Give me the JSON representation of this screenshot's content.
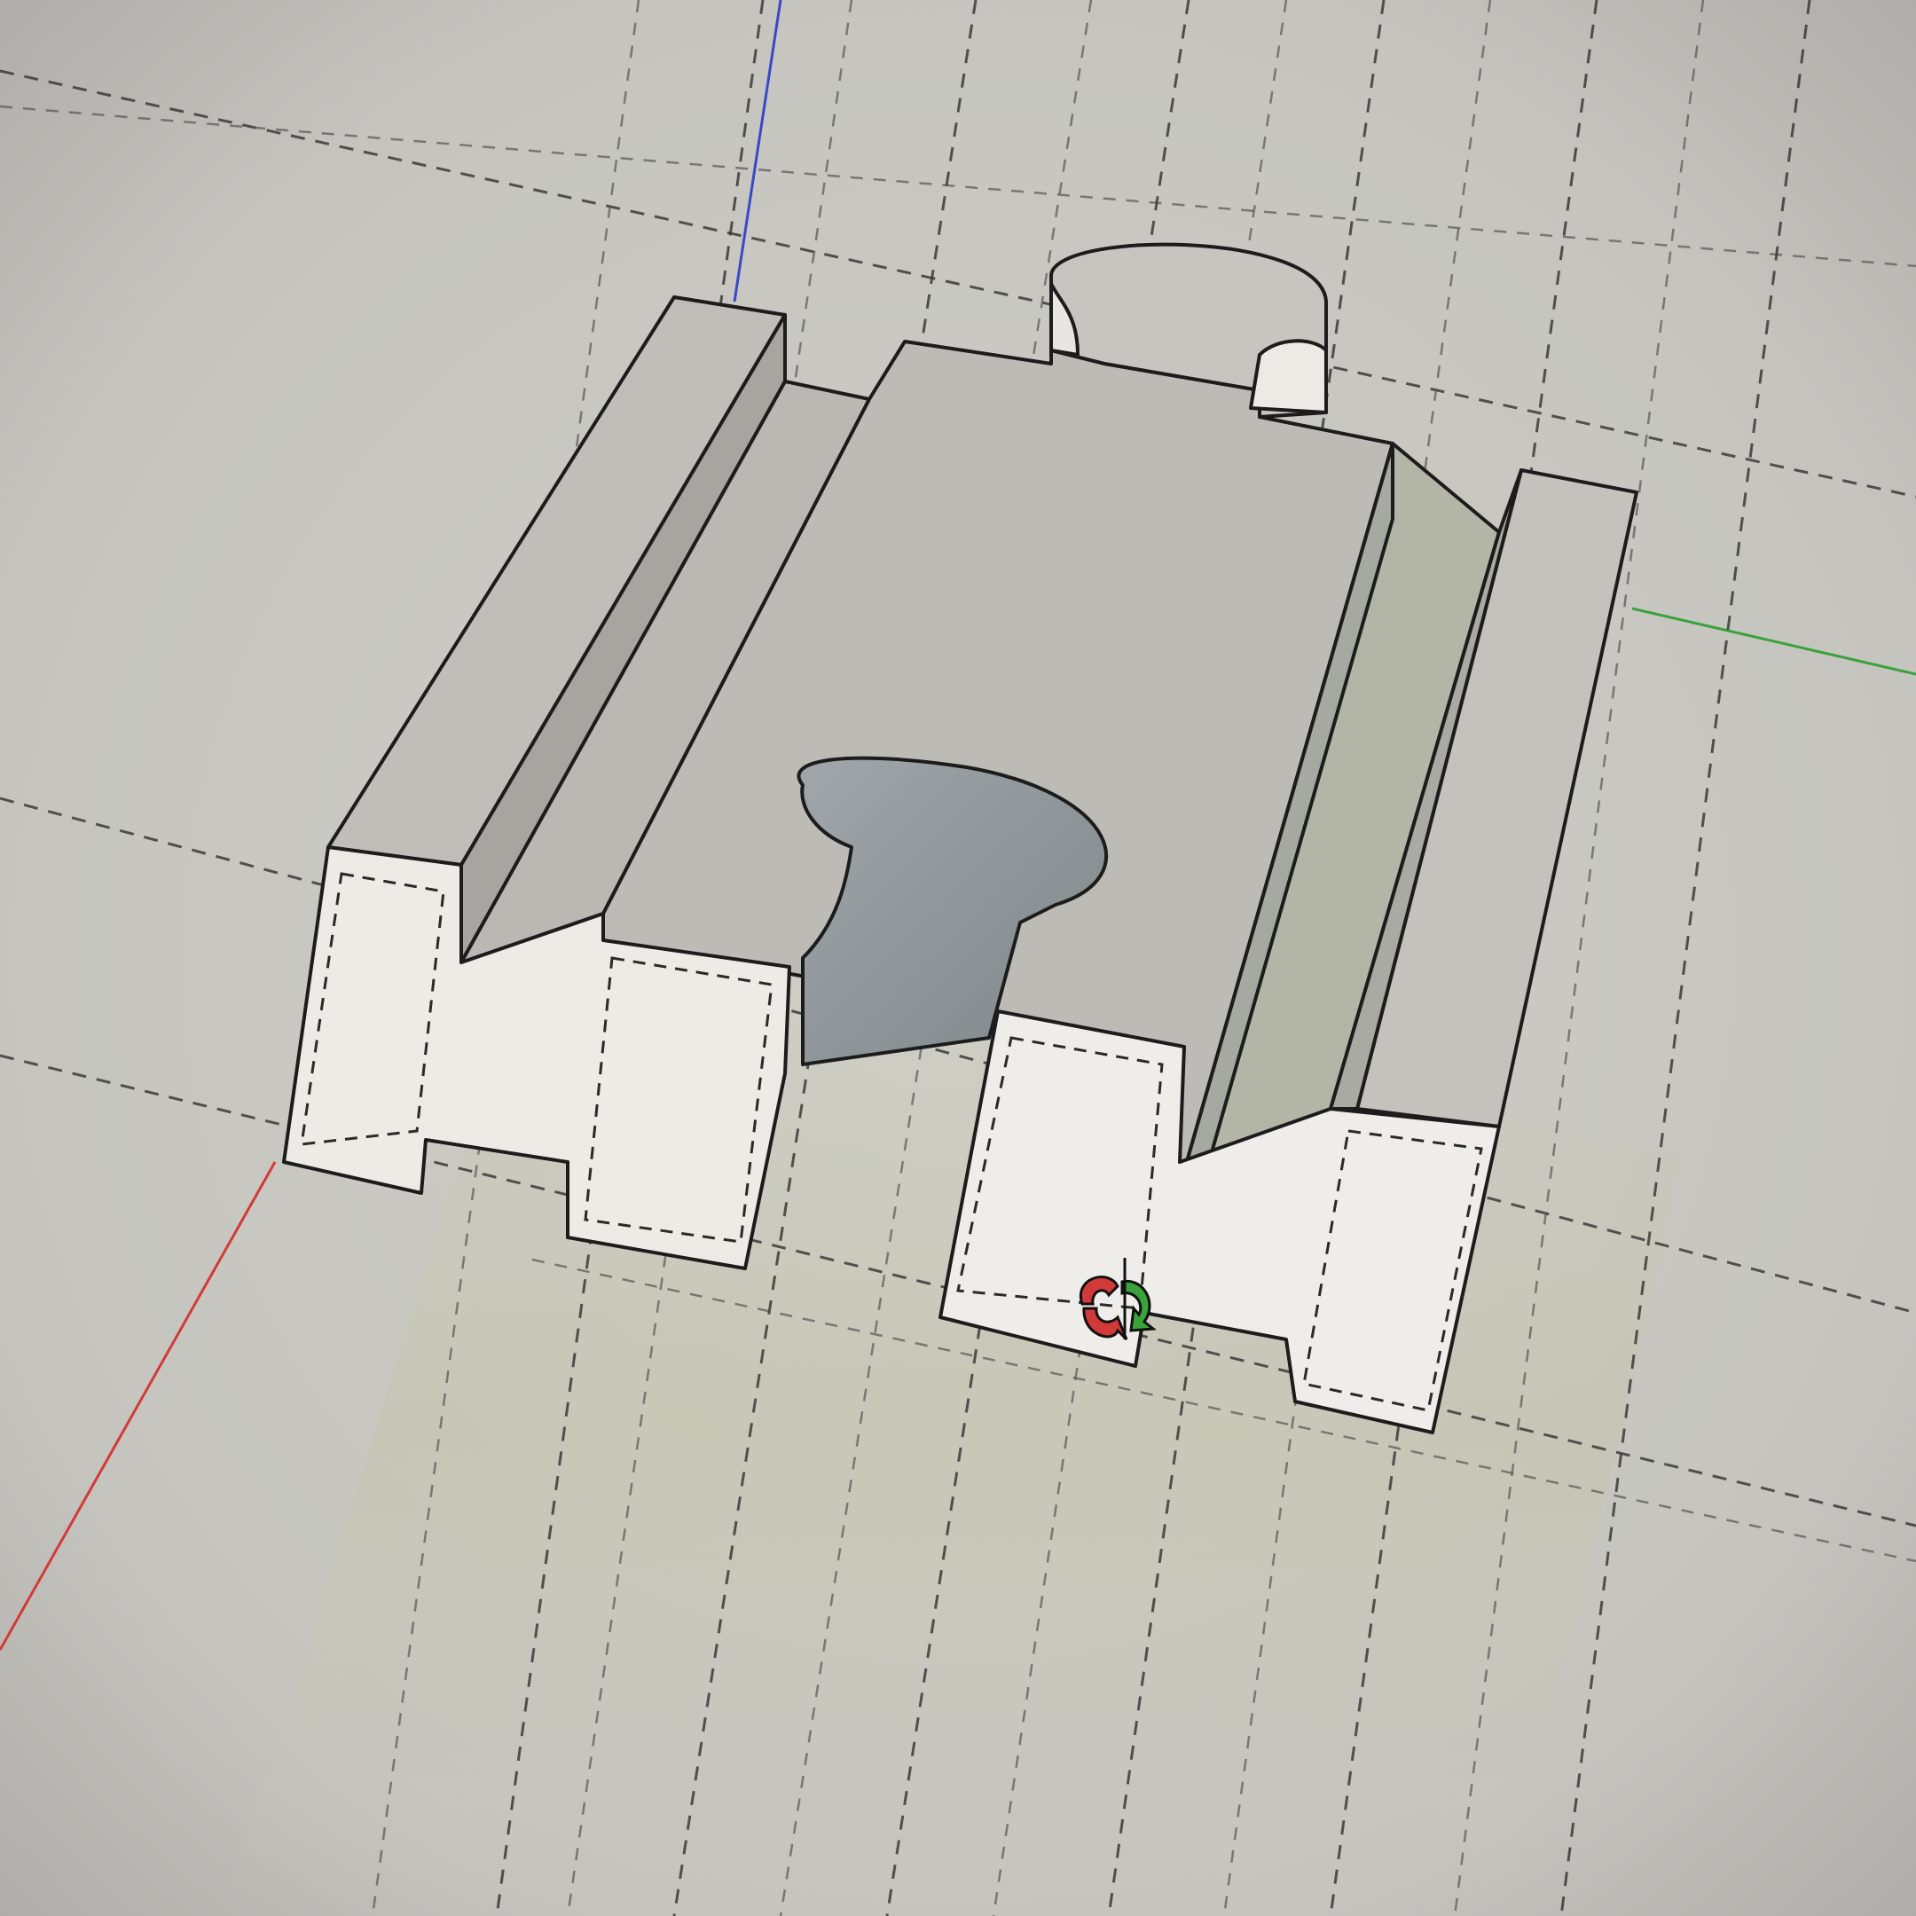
{
  "app": {
    "window_kind": "3d-modeling-viewport"
  },
  "colors": {
    "background": "#c9c8c3",
    "ground_shade": "#c2c2b2",
    "face_front": "#eeece7",
    "face_top": "#bfbdb8",
    "face_side": "#aeaca7",
    "hole": "#8e9598",
    "axis_red": "#d23a3a",
    "axis_green": "#3aa23a",
    "axis_blue": "#3a48c8"
  },
  "icons": {
    "cursor": "orbit-cursor-icon"
  }
}
